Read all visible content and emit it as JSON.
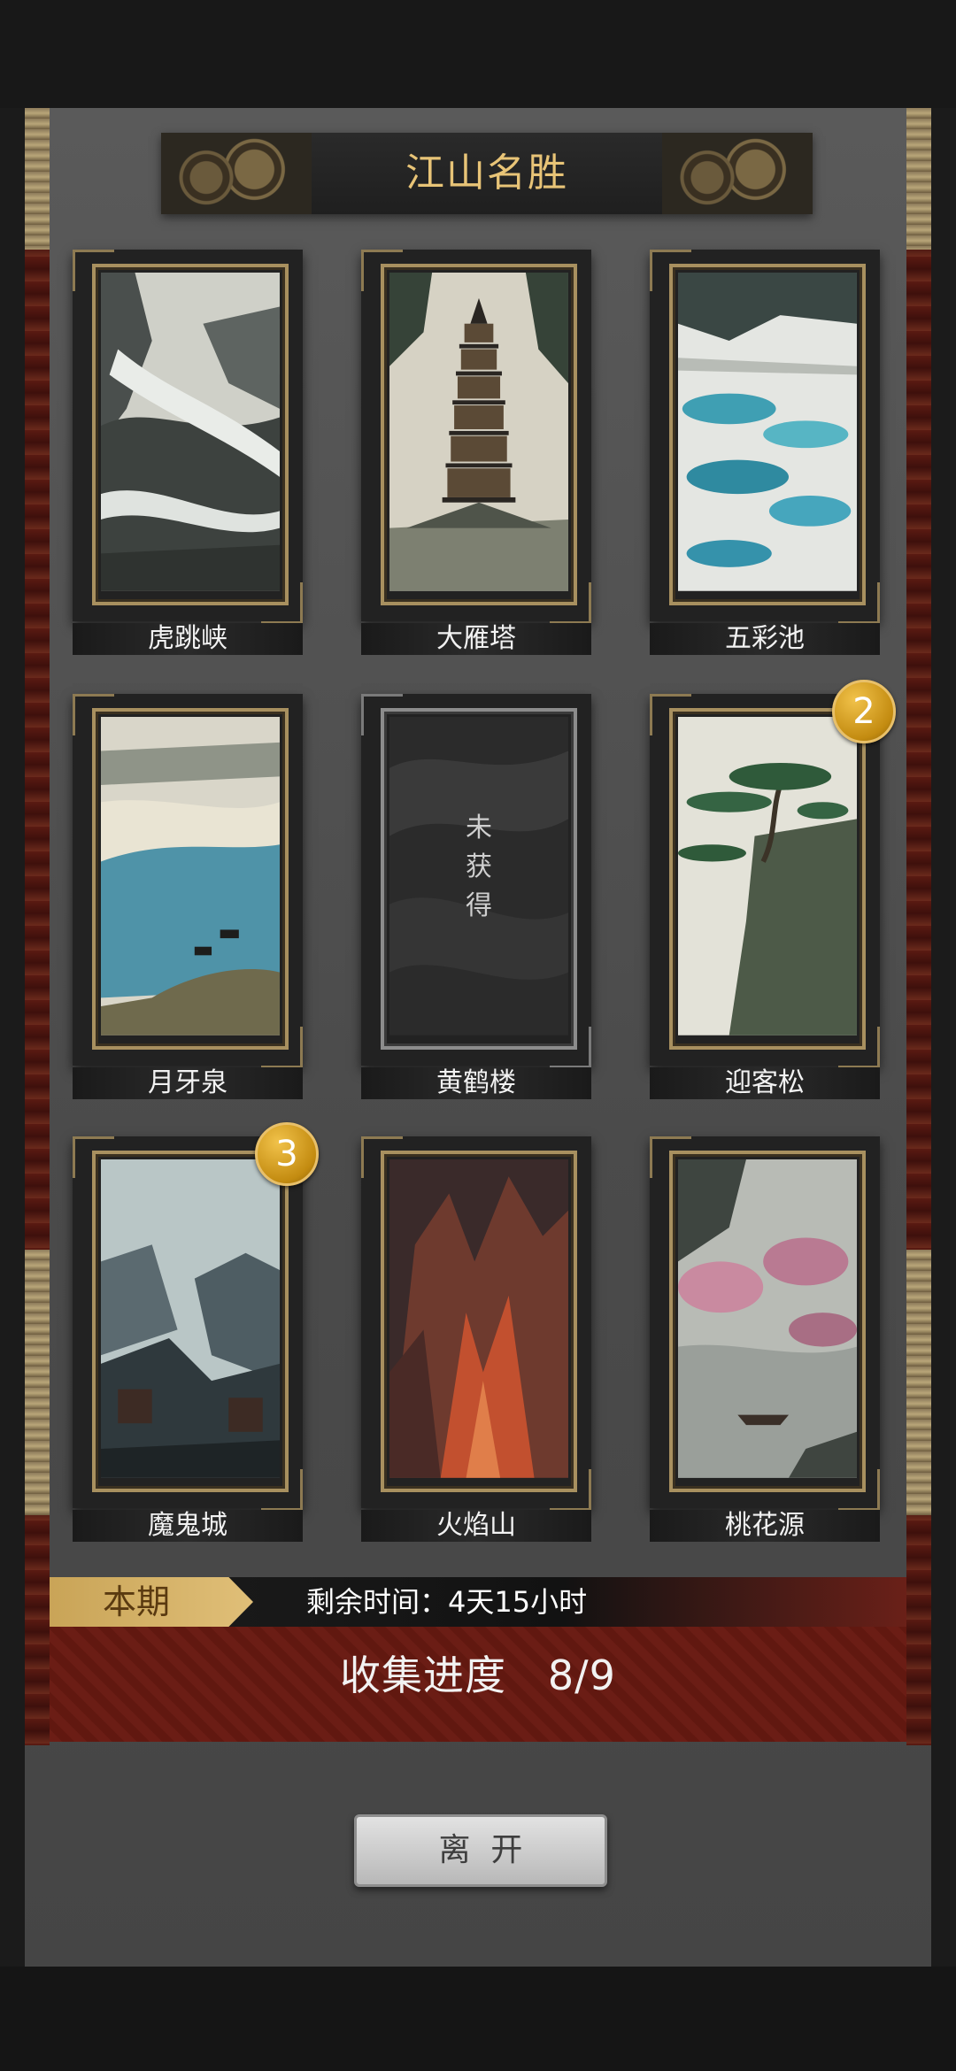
{
  "title": "江山名胜",
  "cards": [
    {
      "name": "虎跳峡"
    },
    {
      "name": "大雁塔"
    },
    {
      "name": "五彩池"
    },
    {
      "name": "月牙泉"
    },
    {
      "name": "黄鹤楼",
      "locked_text": "未\n获\n得"
    },
    {
      "name": "迎客松",
      "badge": "2"
    },
    {
      "name": "魔鬼城",
      "badge": "3"
    },
    {
      "name": "火焰山"
    },
    {
      "name": "桃花源"
    }
  ],
  "period": {
    "tag": "本期",
    "remaining": "剩余时间：4天15小时"
  },
  "progress": {
    "text": "收集进度   8/9",
    "collected": 8,
    "total": 9
  },
  "leave_button": "离  开",
  "colors": {
    "accent_gold": "#e8c477",
    "badge_gold": "#c38b10",
    "progress_red": "#6b1d15"
  }
}
